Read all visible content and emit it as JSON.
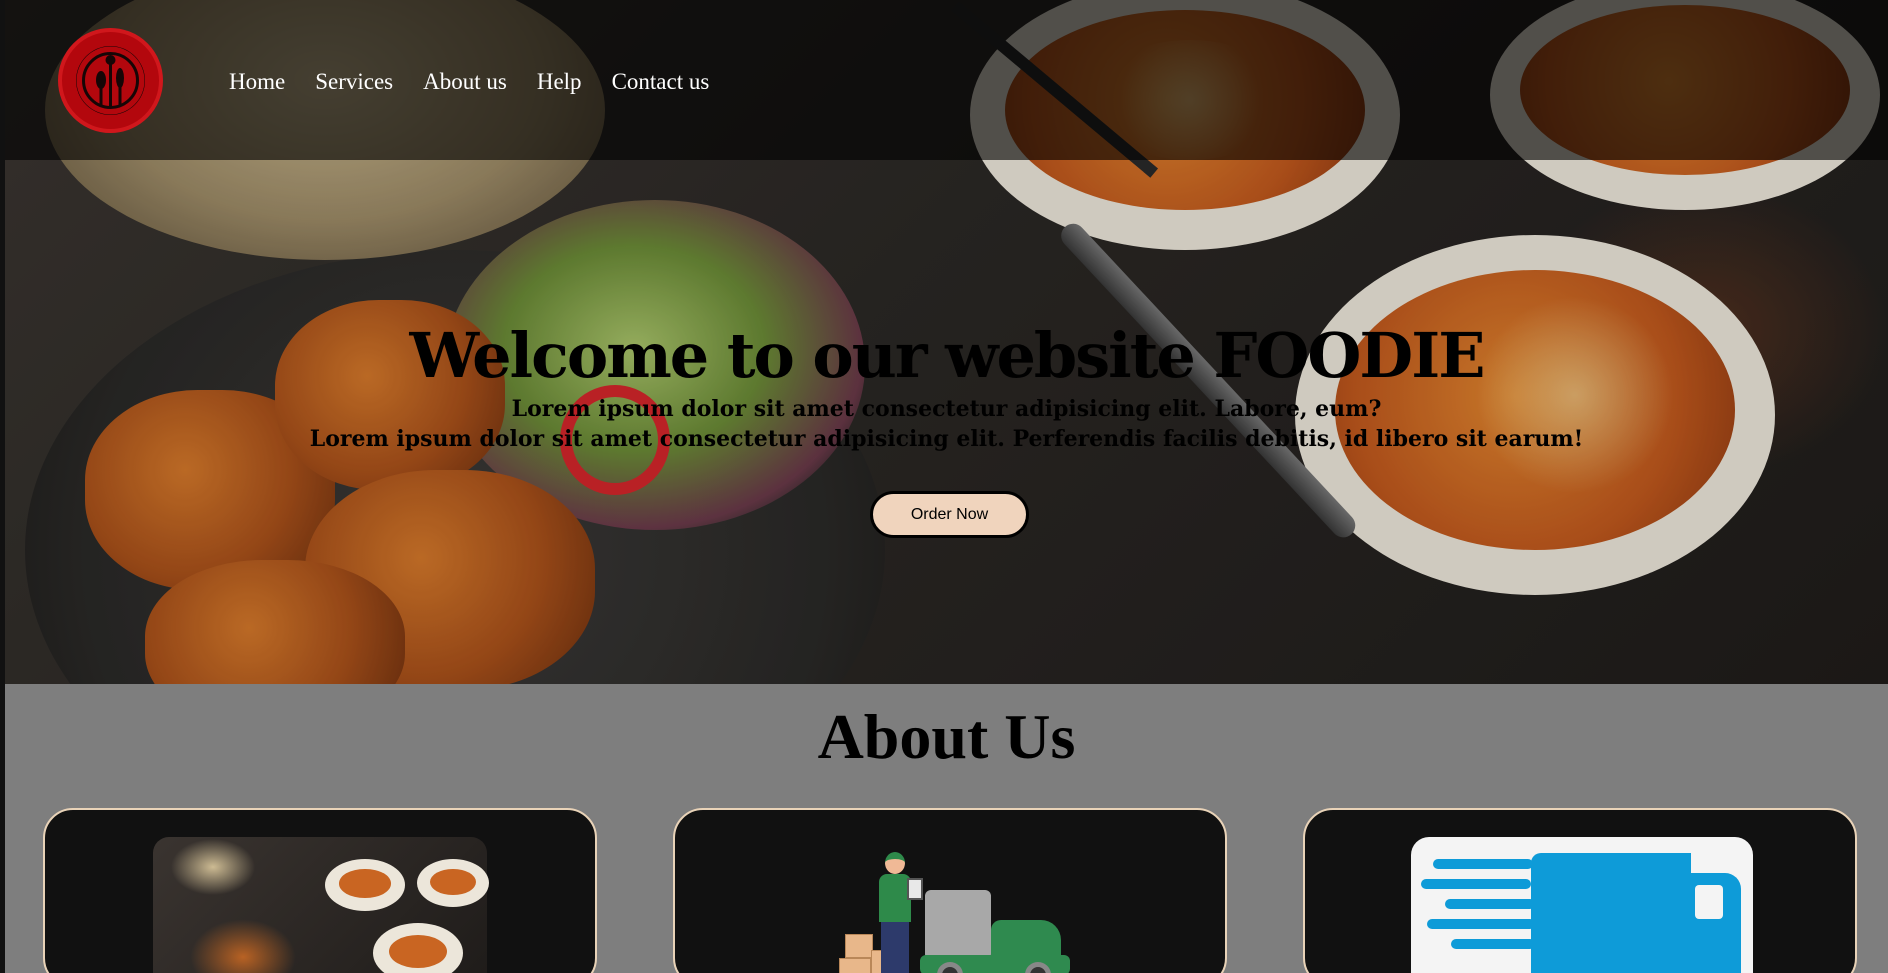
{
  "nav": {
    "logo_icon": "restaurant-logo-icon",
    "links": [
      "Home",
      "Services",
      "About us",
      "Help",
      "Contact us"
    ]
  },
  "hero": {
    "title": "Welcome to our website FOODIE",
    "subtitle_line1": "Lorem ipsum dolor sit amet consectetur adipisicing elit. Labore, eum?",
    "subtitle_line2": "Lorem ipsum dolor sit amet consectetur adipisicing elit. Perferendis facilis debitis, id libero sit earum!",
    "button_label": "Order Now"
  },
  "about": {
    "title": "About Us",
    "cards": [
      {
        "image": "food-platter-image"
      },
      {
        "image": "delivery-man-truck-image"
      },
      {
        "image": "fast-truck-icon"
      }
    ]
  },
  "colors": {
    "nav_overlay": "#000000a8",
    "logo_red": "#b3070d",
    "button_bg": "#f0d4bd",
    "about_bg": "#7e7e7e",
    "card_bg": "#111111",
    "card_border": "#e9d3b8",
    "truck_blue": "#0e9bd8"
  }
}
